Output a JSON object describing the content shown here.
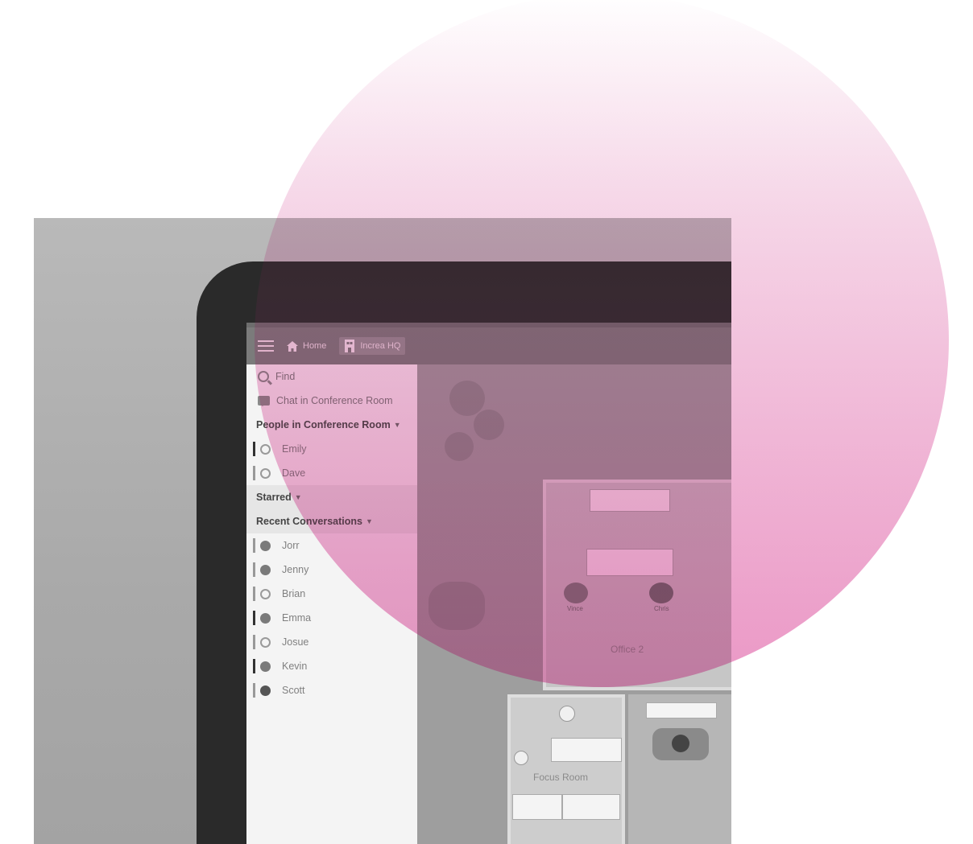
{
  "topbar": {
    "home_label": "Home",
    "location_label": "Increa HQ"
  },
  "sidebar": {
    "find_label": "Find",
    "chat_label": "Chat in Conference Room",
    "people_section": "People in Conference Room",
    "people": [
      {
        "name": "Emily",
        "status": "idle"
      },
      {
        "name": "Dave",
        "status": "idle"
      }
    ],
    "starred_section": "Starred",
    "recent_section": "Recent Conversations",
    "recent": [
      {
        "name": "Jorr",
        "status": "check"
      },
      {
        "name": "Jenny",
        "status": "check"
      },
      {
        "name": "Brian",
        "status": "idle"
      },
      {
        "name": "Emma",
        "status": "check"
      },
      {
        "name": "Josue",
        "status": "idle"
      },
      {
        "name": "Kevin",
        "status": "check"
      },
      {
        "name": "Scott",
        "status": "busy"
      }
    ]
  },
  "map": {
    "office_label": "Office 2",
    "focus_label": "Focus Room",
    "avatar_left_name": "Vince",
    "avatar_right_name": "Chris"
  },
  "colors": {
    "accent_pink": "#e88ec0",
    "topbar": "#7b7b7b",
    "sidebar_bg": "#f4f4f4"
  }
}
